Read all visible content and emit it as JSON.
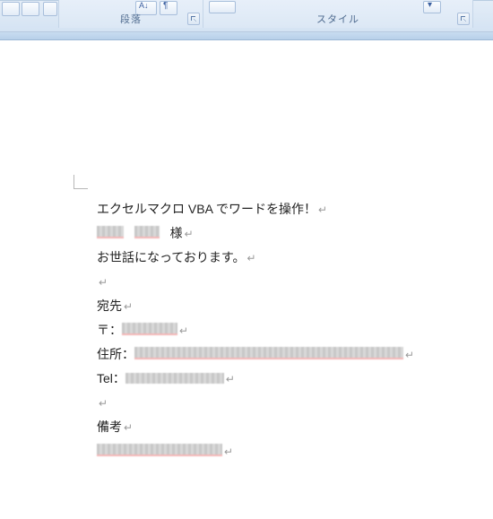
{
  "ribbon": {
    "group_paragraph": "段落",
    "group_styles": "スタイル"
  },
  "doc": {
    "line1": "エクセルマクロ VBA でワードを操作！",
    "honorific": "様",
    "line3": "お世話になっております。",
    "dest_label": "宛先",
    "postal_prefix": "〒：",
    "address_prefix": "住所：",
    "tel_prefix": "Tel：",
    "notes_label": "備考",
    "para_mark": "↵"
  }
}
